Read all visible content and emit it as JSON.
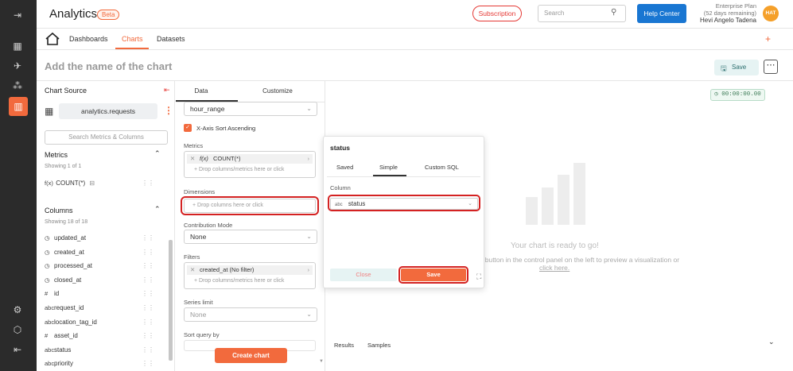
{
  "app": {
    "title": "Analytics",
    "badge": "Beta"
  },
  "topbar": {
    "subscription_label": "Subscription",
    "search_placeholder": "Search",
    "help_label": "Help Center",
    "plan_line1": "Enterprise Plan",
    "plan_line2": "(52 days remaining)",
    "user_name": "Hevi Angelo Tadena",
    "avatar_initials": "HAT"
  },
  "nav": {
    "dashboards": "Dashboards",
    "charts": "Charts",
    "datasets": "Datasets",
    "plus": "+"
  },
  "chart": {
    "name_placeholder": "Add the name of the chart",
    "save_label": "Save",
    "more_label": "⋯"
  },
  "left": {
    "chart_source_title": "Chart Source",
    "dataset_name": "analytics.requests",
    "search_placeholder": "Search Metrics & Columns",
    "metrics_title": "Metrics",
    "metrics_count": "Showing 1 of 1",
    "metrics": [
      {
        "icon": "f(x)",
        "label": "COUNT(*)"
      }
    ],
    "columns_title": "Columns",
    "columns_count": "Showing 18 of 18",
    "columns": [
      {
        "icon": "clock-icon",
        "type": "◷",
        "label": "updated_at"
      },
      {
        "icon": "clock-icon",
        "type": "◷",
        "label": "created_at"
      },
      {
        "icon": "clock-icon",
        "type": "◷",
        "label": "processed_at"
      },
      {
        "icon": "clock-icon",
        "type": "◷",
        "label": "closed_at"
      },
      {
        "icon": "hash-icon",
        "type": "#",
        "label": "id"
      },
      {
        "icon": "abc-icon",
        "type": "abc",
        "label": "request_id"
      },
      {
        "icon": "abc-icon",
        "type": "abc",
        "label": "location_tag_id"
      },
      {
        "icon": "hash-icon",
        "type": "#",
        "label": "asset_id"
      },
      {
        "icon": "abc-icon",
        "type": "abc",
        "label": "status"
      },
      {
        "icon": "abc-icon",
        "type": "abc",
        "label": "priority"
      }
    ]
  },
  "middle": {
    "tab_data": "Data",
    "tab_customize": "Customize",
    "time_range_value": "hour_range",
    "sort_ascending_label": "X-Axis Sort Ascending",
    "metrics_label": "Metrics",
    "metric_chip_fx": "f(x)",
    "metric_chip": "COUNT(*)",
    "metrics_drop": "+ Drop columns/metrics here or click",
    "dimensions_label": "Dimensions",
    "dimensions_drop": "+ Drop columns here or click",
    "contribution_label": "Contribution Mode",
    "contribution_value": "None",
    "filters_label": "Filters",
    "filter_chip": "created_at (No filter)",
    "filters_drop": "+ Drop columns/metrics here or click",
    "series_limit_label": "Series limit",
    "series_limit_value": "None",
    "sort_query_label": "Sort query by",
    "create_chart_label": "Create chart"
  },
  "preview": {
    "timer": "00:00:00.00",
    "ready_title": "Your chart is ready to go!",
    "ready_sub": "t\" button in the control panel on the left to preview a visualization or",
    "ready_link": "click here.",
    "tab_results": "Results",
    "tab_samples": "Samples"
  },
  "popover": {
    "title": "status",
    "tab_saved": "Saved",
    "tab_simple": "Simple",
    "tab_custom_sql": "Custom SQL",
    "column_label": "Column",
    "column_type": "abc",
    "column_value": "status",
    "close_label": "Close",
    "save_label": "Save"
  }
}
